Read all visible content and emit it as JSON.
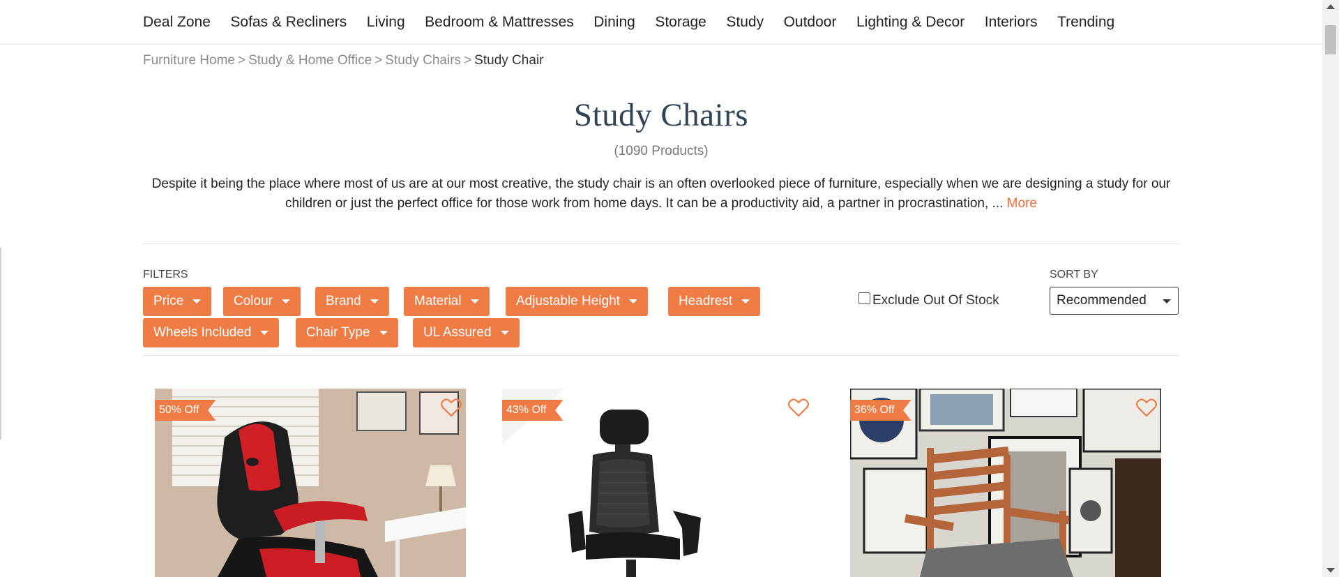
{
  "nav": {
    "items": [
      "Deal Zone",
      "Sofas & Recliners",
      "Living",
      "Bedroom & Mattresses",
      "Dining",
      "Storage",
      "Study",
      "Outdoor",
      "Lighting & Decor",
      "Interiors",
      "Trending"
    ]
  },
  "breadcrumb": {
    "items": [
      "Furniture Home",
      "Study & Home Office",
      "Study Chairs"
    ],
    "separator": ">",
    "current": "Study Chair"
  },
  "page": {
    "title": "Study Chairs",
    "count": "(1090 Products)",
    "description": "Despite it being the place where most of us are at our most creative, the study chair is an often overlooked piece of furniture, especially when we are designing a study for our children or just the perfect office for those work from home days. It can be a productivity aid, a partner in procrastination, ... ",
    "more_label": "More"
  },
  "filters": {
    "label": "FILTERS",
    "chips": [
      "Price",
      "Colour",
      "Brand",
      "Material",
      "Adjustable Height",
      "Headrest",
      "Wheels Included",
      "Chair Type",
      "UL Assured"
    ],
    "exclude_out_of_stock": {
      "label": "Exclude Out Of Stock",
      "checked": false
    }
  },
  "sort": {
    "label": "SORT BY",
    "selected": "Recommended"
  },
  "products": [
    {
      "discount": "50% Off",
      "image": "red-black-gaming-chair"
    },
    {
      "discount": "43% Off",
      "image": "black-mesh-office-chair"
    },
    {
      "discount": "36% Off",
      "image": "wooden-study-chair"
    }
  ],
  "colors": {
    "accent": "#ef7b45",
    "title": "#2f4557",
    "link": "#ef6b34"
  }
}
